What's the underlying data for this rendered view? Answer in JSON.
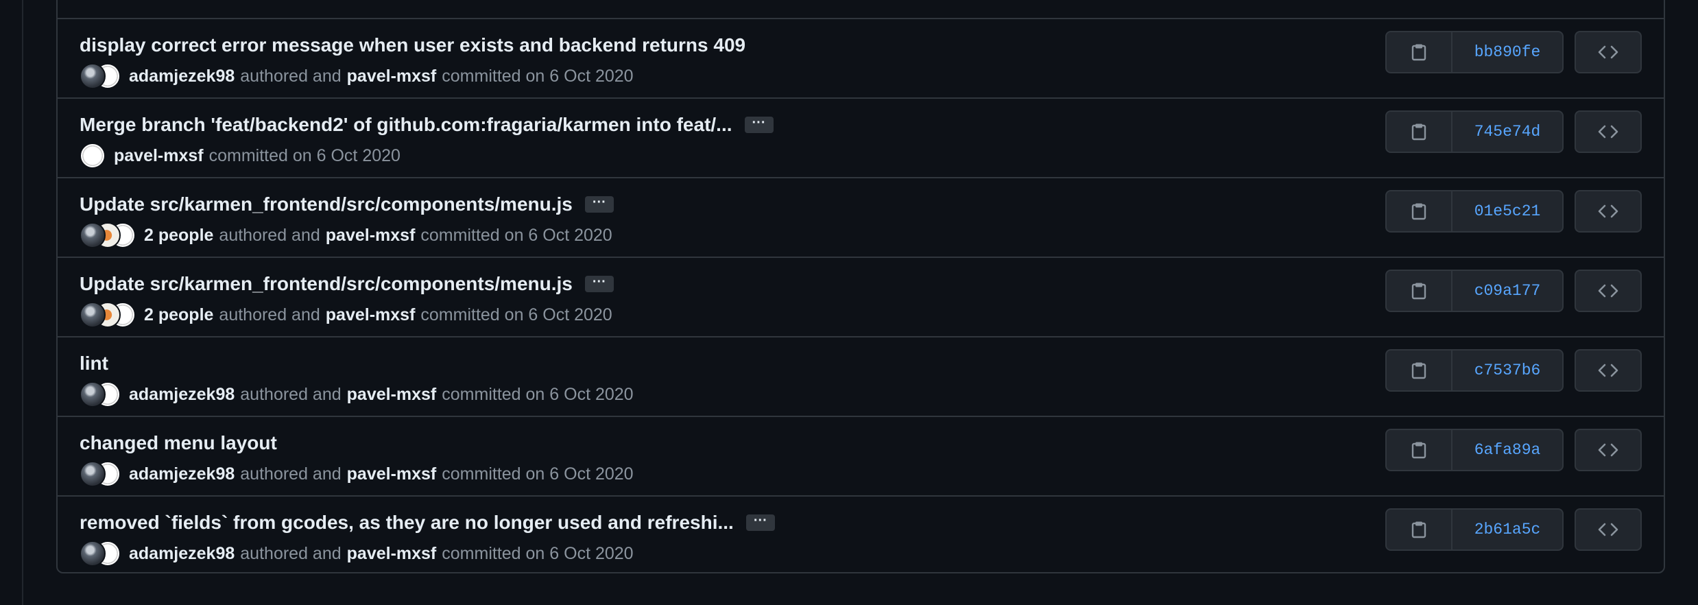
{
  "colors": {
    "background": "#0d1117",
    "border": "#30363d",
    "button_bg": "#21262d",
    "text_primary": "#e6edf3",
    "text_muted": "#8b949e",
    "sha_link": "#58a6ff"
  },
  "icons": {
    "copy": "clipboard-icon",
    "browse": "code-icon",
    "expand": "ellipsis-icon"
  },
  "commits": [
    {
      "title": "display correct error message when user exists and backend returns 409",
      "has_ellipsis": false,
      "author": "adamjezek98",
      "authored_text": "authored and",
      "committer": "pavel-mxsf",
      "committed_text": "committed on 6 Oct 2020",
      "sha": "bb890fe"
    },
    {
      "title": "Merge branch 'feat/backend2' of github.com:fragaria/karmen into feat/...",
      "has_ellipsis": true,
      "author": "",
      "authored_text": "",
      "committer": "pavel-mxsf",
      "committed_text": "committed on 6 Oct 2020",
      "sha": "745e74d"
    },
    {
      "title": "Update src/karmen_frontend/src/components/menu.js",
      "has_ellipsis": true,
      "author": "2 people",
      "authored_text": "authored and",
      "committer": "pavel-mxsf",
      "committed_text": "committed on 6 Oct 2020",
      "sha": "01e5c21"
    },
    {
      "title": "Update src/karmen_frontend/src/components/menu.js",
      "has_ellipsis": true,
      "author": "2 people",
      "authored_text": "authored and",
      "committer": "pavel-mxsf",
      "committed_text": "committed on 6 Oct 2020",
      "sha": "c09a177"
    },
    {
      "title": "lint",
      "has_ellipsis": false,
      "author": "adamjezek98",
      "authored_text": "authored and",
      "committer": "pavel-mxsf",
      "committed_text": "committed on 6 Oct 2020",
      "sha": "c7537b6"
    },
    {
      "title": "changed menu layout",
      "has_ellipsis": false,
      "author": "adamjezek98",
      "authored_text": "authored and",
      "committer": "pavel-mxsf",
      "committed_text": "committed on 6 Oct 2020",
      "sha": "6afa89a"
    },
    {
      "title": "removed `fields` from gcodes, as they are no longer used and refreshi...",
      "has_ellipsis": true,
      "author": "adamjezek98",
      "authored_text": "authored and",
      "committer": "pavel-mxsf",
      "committed_text": "committed on 6 Oct 2020",
      "sha": "2b61a5c"
    }
  ],
  "ellipsis_label": "···"
}
